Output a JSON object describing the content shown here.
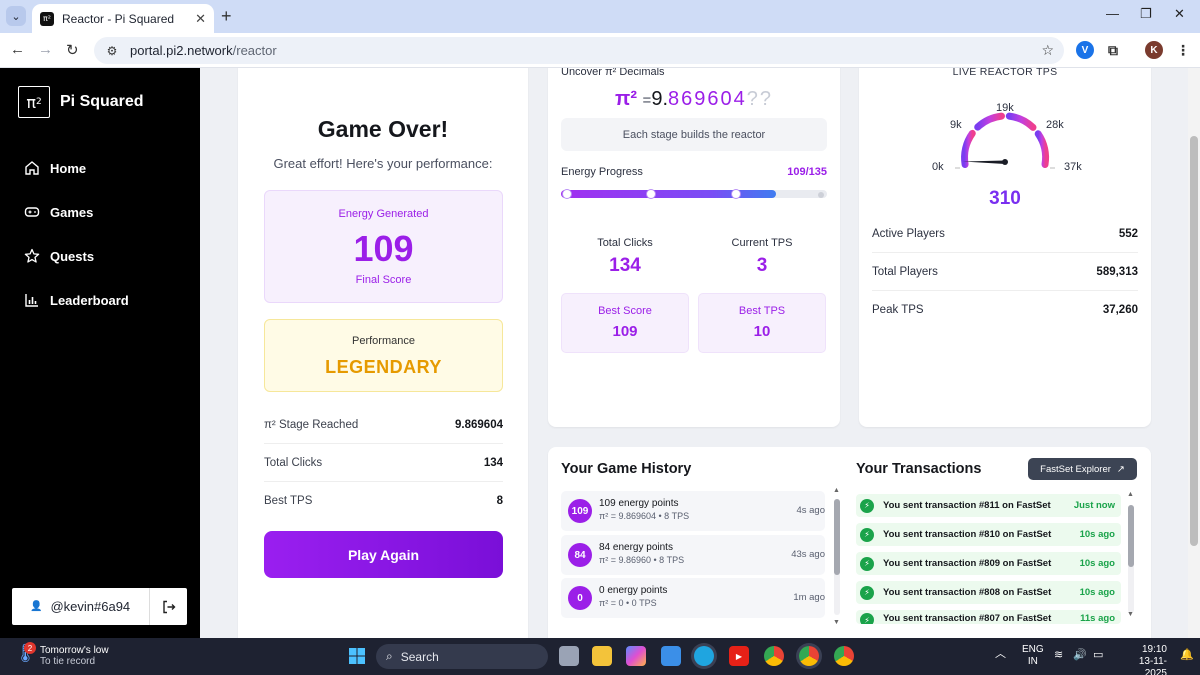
{
  "browser": {
    "tab_title": "Reactor - Pi Squared",
    "url_host": "portal.pi2.network",
    "url_path": "/reactor",
    "profile_initial": "K",
    "ext_initial": "V"
  },
  "sidebar": {
    "brand": "Pi Squared",
    "logo": "π",
    "logo_sup": "2",
    "items": [
      {
        "label": "Home",
        "icon": "home-icon"
      },
      {
        "label": "Games",
        "icon": "gamepad-icon"
      },
      {
        "label": "Quests",
        "icon": "star-icon"
      },
      {
        "label": "Leaderboard",
        "icon": "bar-chart-icon"
      }
    ],
    "user": "@kevin#6a94"
  },
  "game_over": {
    "title": "Game Over!",
    "subtitle": "Great effort! Here's your performance:",
    "energy_label": "Energy Generated",
    "energy_value": "109",
    "energy_caption": "Final Score",
    "performance_label": "Performance",
    "performance_value": "LEGENDARY",
    "stats": [
      {
        "label": "π² Stage Reached",
        "value": "9.869604"
      },
      {
        "label": "Total Clicks",
        "value": "134"
      },
      {
        "label": "Best TPS",
        "value": "8"
      }
    ],
    "play_again": "Play Again"
  },
  "reactor": {
    "uncover_label": "Uncover π² Decimals",
    "pi_symbol": "π²",
    "pi_equals": "=",
    "pi_integer": "9",
    "pi_dot": ".",
    "pi_digits": "869604",
    "pi_unknown": "??",
    "stage_text": "Each stage builds the reactor",
    "energy_progress_label": "Energy Progress",
    "energy_progress_value": "109/135",
    "energy_progress_fraction": 0.807,
    "total_clicks_label": "Total Clicks",
    "total_clicks": "134",
    "current_tps_label": "Current TPS",
    "current_tps": "3",
    "best_score_label": "Best Score",
    "best_score": "109",
    "best_tps_label": "Best TPS",
    "best_tps": "10"
  },
  "tps_panel": {
    "title": "LIVE REACTOR TPS",
    "gauge_labels": [
      "0k",
      "9k",
      "19k",
      "28k",
      "37k"
    ],
    "gauge_value": "310",
    "rows": [
      {
        "label": "Active Players",
        "value": "552",
        "accent": true
      },
      {
        "label": "Total Players",
        "value": "589,313",
        "accent": false
      },
      {
        "label": "Peak TPS",
        "value": "37,260",
        "accent": false
      }
    ]
  },
  "history": {
    "title": "Your Game History",
    "items": [
      {
        "badge": "109",
        "main": "109 energy points",
        "sub": "π² = 9.869604 • 8 TPS",
        "time": "4s ago"
      },
      {
        "badge": "84",
        "main": "84 energy points",
        "sub": "π² = 9.86960 • 8 TPS",
        "time": "43s ago"
      },
      {
        "badge": "0",
        "main": "0 energy points",
        "sub": "π² = 0 • 0 TPS",
        "time": "1m ago"
      }
    ]
  },
  "transactions": {
    "title": "Your Transactions",
    "explorer_button": "FastSet Explorer",
    "items": [
      {
        "text": "You sent transaction #811 on FastSet",
        "time": "Just now"
      },
      {
        "text": "You sent transaction #810 on FastSet",
        "time": "10s ago"
      },
      {
        "text": "You sent transaction #809 on FastSet",
        "time": "10s ago"
      },
      {
        "text": "You sent transaction #808 on FastSet",
        "time": "10s ago"
      },
      {
        "text": "You sent transaction #807 on FastSet",
        "time": "11s ago"
      }
    ]
  },
  "taskbar": {
    "weather_line1": "Tomorrow's low",
    "weather_line2": "To tie record",
    "weather_badge": "2",
    "search_placeholder": "Search",
    "lang_line1": "ENG",
    "lang_line2": "IN",
    "time": "19:10",
    "date": "13-11-2025"
  },
  "colors": {
    "accent_purple": "#9b1fe8",
    "legendary_gold": "#e69a00",
    "success_green": "#1aa34a"
  }
}
